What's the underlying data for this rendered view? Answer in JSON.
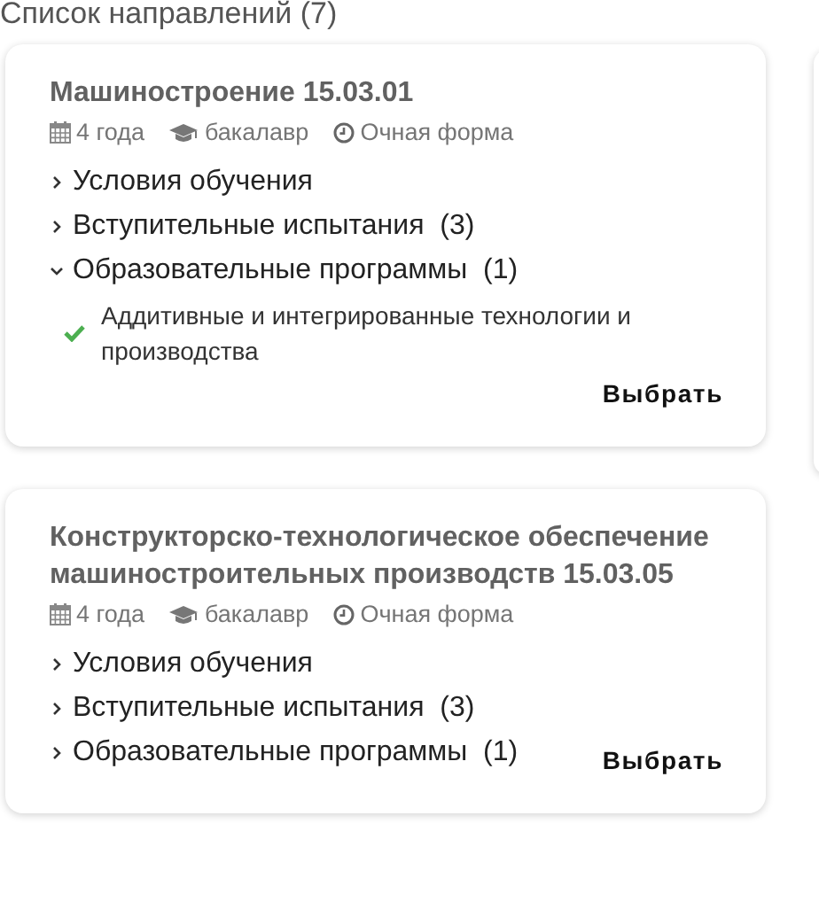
{
  "heading": "Список направлений (7)",
  "directions": [
    {
      "title": "Машиностроение 15.03.01",
      "duration": "4 года",
      "level": "бакалавр",
      "form": "Очная форма",
      "sections": [
        {
          "label": "Условия обучения",
          "expanded": false
        },
        {
          "label": "Вступительные испытания",
          "count": "(3)",
          "expanded": false
        },
        {
          "label": "Образовательные программы",
          "count": "(1)",
          "expanded": true,
          "items": [
            {
              "label": "Аддитивные и интегрированные технологии и производства",
              "checked": true
            }
          ]
        }
      ],
      "action": "Выбрать"
    },
    {
      "title": "Конструкторско-технологическое обеспечение машиностроительных производств 15.03.05",
      "duration": "4 года",
      "level": "бакалавр",
      "form": "Очная форма",
      "sections": [
        {
          "label": "Условия обучения",
          "expanded": false
        },
        {
          "label": "Вступительные испытания",
          "count": "(3)",
          "expanded": false
        },
        {
          "label": "Образовательные программы",
          "count": "(1)",
          "expanded": false
        }
      ],
      "action": "Выбрать"
    }
  ]
}
